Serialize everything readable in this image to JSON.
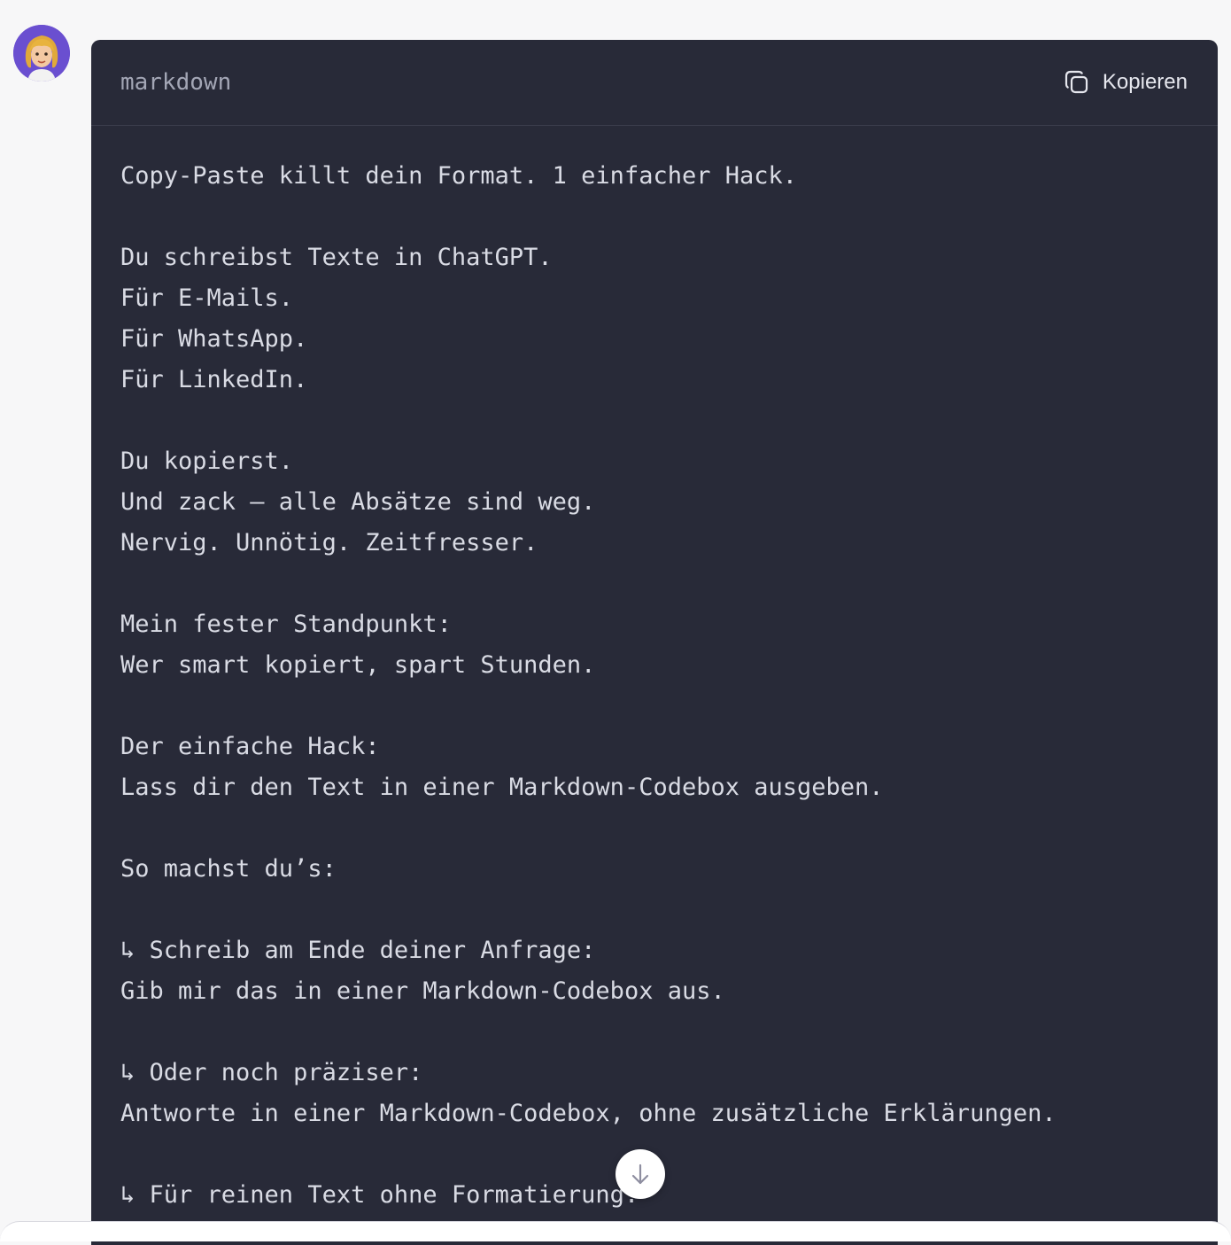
{
  "message": {
    "avatar_icon": "user-avatar-icon",
    "codebox": {
      "language": "markdown",
      "copy_label": "Kopieren",
      "copy_icon": "copy-icon",
      "lines": [
        "Copy-Paste killt dein Format. 1 einfacher Hack.",
        "",
        "Du schreibst Texte in ChatGPT.",
        "Für E-Mails.",
        "Für WhatsApp.",
        "Für LinkedIn.",
        "",
        "Du kopierst.",
        "Und zack – alle Absätze sind weg.",
        "Nervig. Unnötig. Zeitfresser.",
        "",
        "Mein fester Standpunkt:",
        "Wer smart kopiert, spart Stunden.",
        "",
        "Der einfache Hack:",
        "Lass dir den Text in einer Markdown-Codebox ausgeben.",
        "",
        "So machst du’s:",
        "",
        "↳ Schreib am Ende deiner Anfrage:",
        "Gib mir das in einer Markdown-Codebox aus.",
        "",
        "↳ Oder noch präziser:",
        "Antworte in einer Markdown-Codebox, ohne zusätzliche Erklärungen.",
        "",
        "↳ Für reinen Text ohne Formatierung:"
      ]
    }
  },
  "scroll_down_icon": "arrow-down-icon"
}
